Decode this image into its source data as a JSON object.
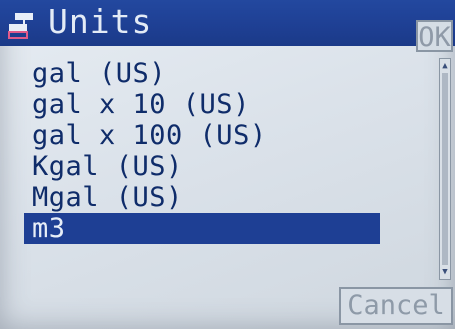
{
  "window": {
    "title": "Units",
    "icon": "network-icon"
  },
  "toolbar": {
    "ok_label": "OK",
    "cancel_label": "Cancel"
  },
  "units_list": {
    "items": [
      {
        "label": "gal (US)",
        "selected": false
      },
      {
        "label": "gal x 10 (US)",
        "selected": false
      },
      {
        "label": "gal x 100 (US)",
        "selected": false
      },
      {
        "label": "Kgal (US)",
        "selected": false
      },
      {
        "label": "Mgal (US)",
        "selected": false
      },
      {
        "label": "m3",
        "selected": true
      }
    ]
  },
  "colors": {
    "title_bar": "#1e3f93",
    "selection": "#1e3f94",
    "text": "#0f2c6a",
    "background": "#dbe2ea"
  }
}
